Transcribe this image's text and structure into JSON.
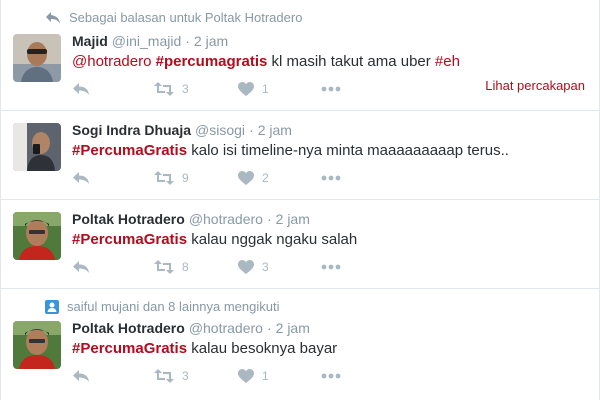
{
  "colors": {
    "accent": "#b30c1e",
    "muted": "#8899a6",
    "icon": "#aab8c2",
    "border": "#e1e8ed",
    "follow_icon": "#3b94d9"
  },
  "tweets": [
    {
      "context": {
        "icon": "reply-arrow-icon",
        "text": "Sebagai balasan untuk Poltak Hotradero"
      },
      "name": "Majid",
      "handle": "@ini_majid",
      "sep": "·",
      "time": "2 jam",
      "text": [
        {
          "type": "mention",
          "value": "@hotradero"
        },
        {
          "type": "plain",
          "value": " "
        },
        {
          "type": "hashtag",
          "value": "#percumagratis"
        },
        {
          "type": "plain",
          "value": " kl masih takut ama uber "
        },
        {
          "type": "mention",
          "value": "#eh"
        }
      ],
      "replies": "",
      "retweets": "3",
      "likes": "1",
      "convo": "Lihat percakapan"
    },
    {
      "name": "Sogi Indra Dhuaja",
      "handle": "@sisogi",
      "sep": "·",
      "time": "2 jam",
      "text": [
        {
          "type": "hashtag",
          "value": "#PercumaGratis"
        },
        {
          "type": "plain",
          "value": " kalo isi timeline-nya minta maaaaaaaaap terus.."
        }
      ],
      "replies": "",
      "retweets": "9",
      "likes": "2"
    },
    {
      "name": "Poltak Hotradero",
      "handle": "@hotradero",
      "sep": "·",
      "time": "2 jam",
      "text": [
        {
          "type": "hashtag",
          "value": "#PercumaGratis"
        },
        {
          "type": "plain",
          "value": " kalau nggak ngaku salah"
        }
      ],
      "replies": "",
      "retweets": "8",
      "likes": "3"
    },
    {
      "context": {
        "icon": "follow-icon",
        "text": "saiful mujani dan 8 lainnya mengikuti"
      },
      "name": "Poltak Hotradero",
      "handle": "@hotradero",
      "sep": "·",
      "time": "2 jam",
      "text": [
        {
          "type": "hashtag",
          "value": "#PercumaGratis"
        },
        {
          "type": "plain",
          "value": " kalau besoknya bayar"
        }
      ],
      "replies": "",
      "retweets": "3",
      "likes": "1"
    }
  ]
}
